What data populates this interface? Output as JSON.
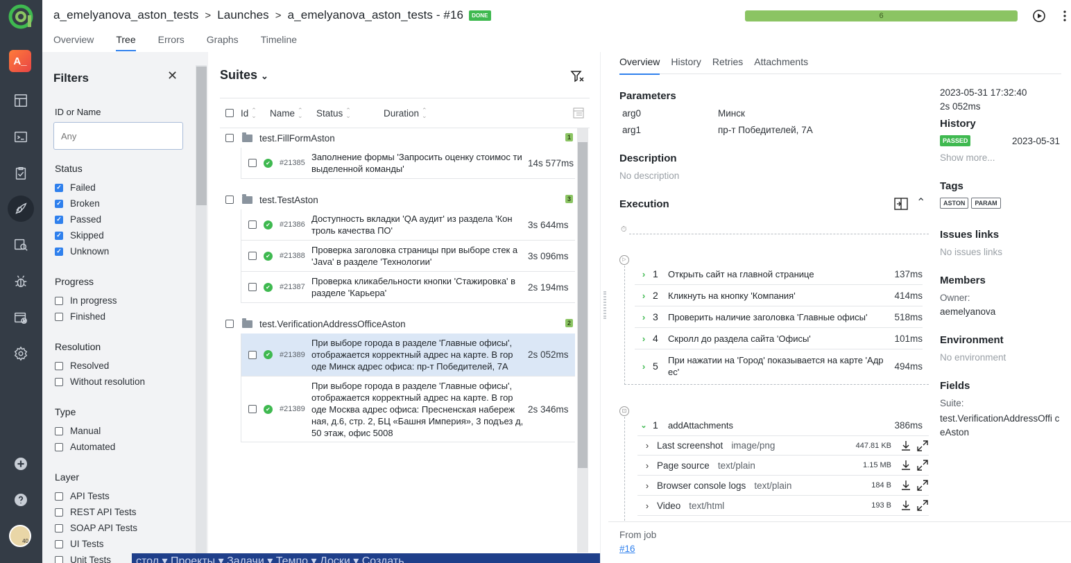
{
  "breadcrumb": {
    "project": "a_emelyanova_aston_tests",
    "launches": "Launches",
    "launch": "a_emelyanova_aston_tests - #16",
    "status_badge": "DONE"
  },
  "progress": {
    "label": "6",
    "fraction": 1.0
  },
  "tabs": [
    "Overview",
    "Tree",
    "Errors",
    "Graphs",
    "Timeline"
  ],
  "active_tab": "Tree",
  "rail": {
    "project_initials": "A_",
    "avatar_badge": "40"
  },
  "filters": {
    "title": "Filters",
    "id_label": "ID or Name",
    "id_placeholder": "Any",
    "status_title": "Status",
    "status": [
      {
        "label": "Failed",
        "checked": true
      },
      {
        "label": "Broken",
        "checked": true
      },
      {
        "label": "Passed",
        "checked": true
      },
      {
        "label": "Skipped",
        "checked": true
      },
      {
        "label": "Unknown",
        "checked": true
      }
    ],
    "progress_title": "Progress",
    "progress": [
      "In progress",
      "Finished"
    ],
    "resolution_title": "Resolution",
    "resolution": [
      "Resolved",
      "Without resolution"
    ],
    "type_title": "Type",
    "type": [
      "Manual",
      "Automated"
    ],
    "layer_title": "Layer",
    "layer": [
      "API Tests",
      "REST API Tests",
      "SOAP API Tests",
      "UI Tests",
      "Unit Tests"
    ]
  },
  "suites": {
    "title": "Suites",
    "columns": [
      "Id",
      "Name",
      "Status",
      "Duration"
    ],
    "groups": [
      {
        "name": "test.FillFormAston",
        "count": "1",
        "tests": [
          {
            "id": "#21385",
            "name": "Заполнение формы 'Запросить оценку стоимос ти выделенной команды'",
            "duration": "14s 577ms"
          }
        ]
      },
      {
        "name": "test.TestAston",
        "count": "3",
        "tests": [
          {
            "id": "#21386",
            "name": "Доступность вкладки 'QA аудит' из раздела 'Кон троль качества ПО'",
            "duration": "3s 644ms"
          },
          {
            "id": "#21388",
            "name": "Проверка заголовка страницы при выборе стек а 'Java' в разделе 'Технологии'",
            "duration": "3s 096ms"
          },
          {
            "id": "#21387",
            "name": "Проверка кликабельности кнопки 'Стажировка' в разделе 'Карьера'",
            "duration": "2s 194ms"
          }
        ]
      },
      {
        "name": "test.VerificationAddressOfficeAston",
        "count": "2",
        "tests": [
          {
            "id": "#21389",
            "name": "При выборе города в разделе 'Главные офисы', отображается корректный адрес на карте. В гор оде Минск адрес офиса: пр-т Победителей, 7А",
            "duration": "2s 052ms"
          },
          {
            "id": "#21389",
            "name": "При выборе города в разделе 'Главные офисы', отображается корректный адрес на карте. В гор оде Москва адрес офиса: Пресненская набереж ная, д.6, стр. 2, БЦ «Башня Империя», 3 подъез д, 50 этаж, офис 5008",
            "duration": "2s 346ms"
          }
        ]
      }
    ]
  },
  "details": {
    "tabs": [
      "Overview",
      "History",
      "Retries",
      "Attachments"
    ],
    "parameters_title": "Parameters",
    "parameters": [
      {
        "name": "arg0",
        "value": "Минск"
      },
      {
        "name": "arg1",
        "value": "пр-т Победителей, 7А"
      }
    ],
    "description_title": "Description",
    "description": "No description",
    "execution_title": "Execution",
    "steps": [
      {
        "n": "1",
        "name": "Открыть сайт на главной странице",
        "duration": "137ms"
      },
      {
        "n": "2",
        "name": "Кликнуть на кнопку 'Компания'",
        "duration": "414ms"
      },
      {
        "n": "3",
        "name": "Проверить наличие заголовка 'Главные офисы'",
        "duration": "518ms"
      },
      {
        "n": "4",
        "name": "Скролл до раздела сайта 'Офисы'",
        "duration": "101ms"
      },
      {
        "n": "5",
        "name": "При нажатии на 'Город' показывается на карте 'Адр ес'",
        "duration": "494ms"
      }
    ],
    "teardown_step": {
      "n": "1",
      "name": "addAttachments",
      "duration": "386ms"
    },
    "attachments": [
      {
        "name": "Last screenshot",
        "mime": "image/png",
        "size": "447.81 KB"
      },
      {
        "name": "Page source",
        "mime": "text/plain",
        "size": "1.15 MB"
      },
      {
        "name": "Browser console logs",
        "mime": "text/plain",
        "size": "184 B"
      },
      {
        "name": "Video",
        "mime": "text/html",
        "size": "193 B"
      }
    ],
    "from_job_label": "From job",
    "from_job_link": "#16"
  },
  "sidebar": {
    "datetime": "2023-05-31 17:32:40",
    "duration": "2s 052ms",
    "history_title": "History",
    "history_status": "PASSED",
    "history_date": "2023-05-31",
    "show_more": "Show more...",
    "tags_title": "Tags",
    "tags": [
      "ASTON",
      "PARAM"
    ],
    "issues_title": "Issues links",
    "issues_empty": "No issues links",
    "members_title": "Members",
    "owner_label": "Owner:",
    "owner": "aemelyanova",
    "environment_title": "Environment",
    "environment_empty": "No environment",
    "fields_title": "Fields",
    "suite_label": "Suite:",
    "suite_value": "test.VerificationAddressOffi ceAston"
  },
  "taskbar_text": "стол ▾   Проекты ▾   Задачи ▾   Темпо ▾   Доски ▾   Создать",
  "colors": {
    "accent": "#2f80ed",
    "passed": "#3fb950",
    "progress": "#8bc463",
    "rail": "#343c46"
  }
}
